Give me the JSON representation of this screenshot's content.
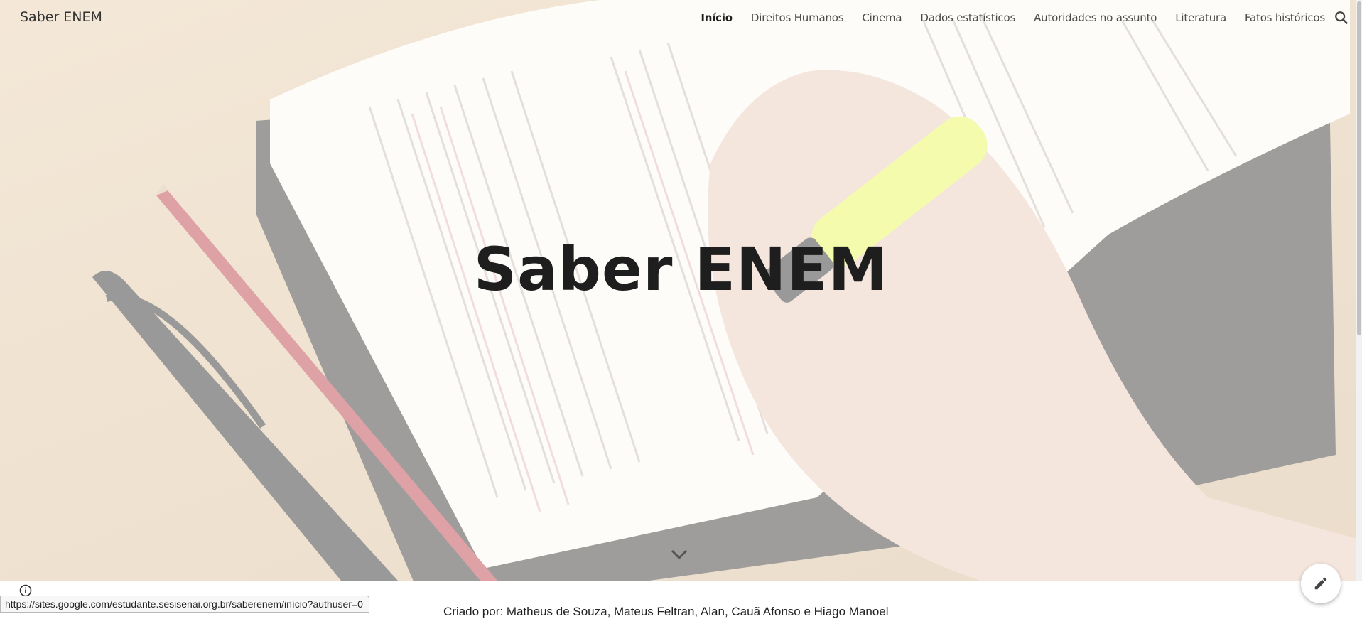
{
  "site": {
    "title": "Saber ENEM"
  },
  "nav": {
    "items": [
      {
        "label": "Início",
        "active": true
      },
      {
        "label": "Direitos Humanos"
      },
      {
        "label": "Cinema"
      },
      {
        "label": "Dados estatísticos"
      },
      {
        "label": "Autoridades no assunto"
      },
      {
        "label": "Literatura"
      },
      {
        "label": "Fatos históricos"
      }
    ],
    "search_icon": "search-icon"
  },
  "hero": {
    "title": "Saber ENEM",
    "scroll_icon": "chevron-down-icon"
  },
  "content": {
    "credits": "Criado por: Matheus de Souza, Mateus Feltran, Alan, Cauã Afonso e Hiago Manoel"
  },
  "status_bar": {
    "url": "https://sites.google.com/estudante.sesisenai.org.br/saberenem/início?authuser=0"
  },
  "fab": {
    "icon": "pencil-icon"
  },
  "colors": {
    "accent_text": "#1e1e1e",
    "highlighter": "#e8f54a",
    "pencil": "#b5303a"
  }
}
